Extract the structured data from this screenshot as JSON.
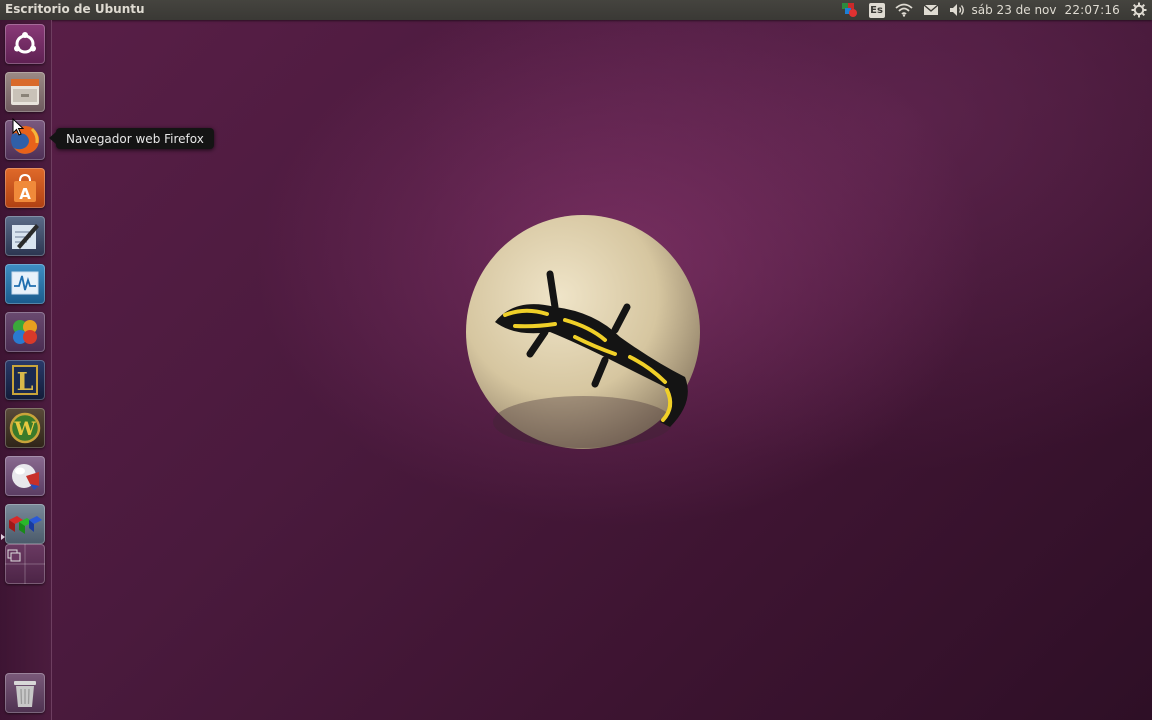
{
  "top_panel": {
    "window_title": "Escritorio de Ubuntu",
    "keyboard_layout": "Es",
    "date": "sáb 23 de nov",
    "time": "22:07:16",
    "icons": [
      "app-indicator-icon",
      "keyboard-layout-indicator",
      "wifi-icon",
      "mail-icon",
      "volume-icon",
      "gear-icon"
    ]
  },
  "launcher": {
    "items": [
      {
        "name": "dash-home",
        "icon": "ubuntu-logo-icon"
      },
      {
        "name": "files",
        "icon": "file-cabinet-icon"
      },
      {
        "name": "firefox",
        "icon": "firefox-icon"
      },
      {
        "name": "software-center",
        "icon": "shopping-bag-icon"
      },
      {
        "name": "text-editor",
        "icon": "pen-icon"
      },
      {
        "name": "system-monitor",
        "icon": "monitor-graph-icon"
      },
      {
        "name": "playonlinux",
        "icon": "clover-icon"
      },
      {
        "name": "league-of-legends",
        "icon": "letter-l-icon"
      },
      {
        "name": "world-of-warcraft",
        "icon": "letter-w-icon"
      },
      {
        "name": "disk-app",
        "icon": "sphere-icon"
      },
      {
        "name": "compiz-config",
        "icon": "cubes-icon"
      },
      {
        "name": "workspace-switcher",
        "icon": "workspace-icon"
      },
      {
        "name": "trash",
        "icon": "trash-icon"
      }
    ],
    "tooltip": "Navegador web Firefox"
  },
  "colors": {
    "panel_bg": "#3a3935",
    "panel_text": "#dfdbd2",
    "desktop_purple": "#4a1a3d",
    "accent_orange": "#e95420"
  }
}
